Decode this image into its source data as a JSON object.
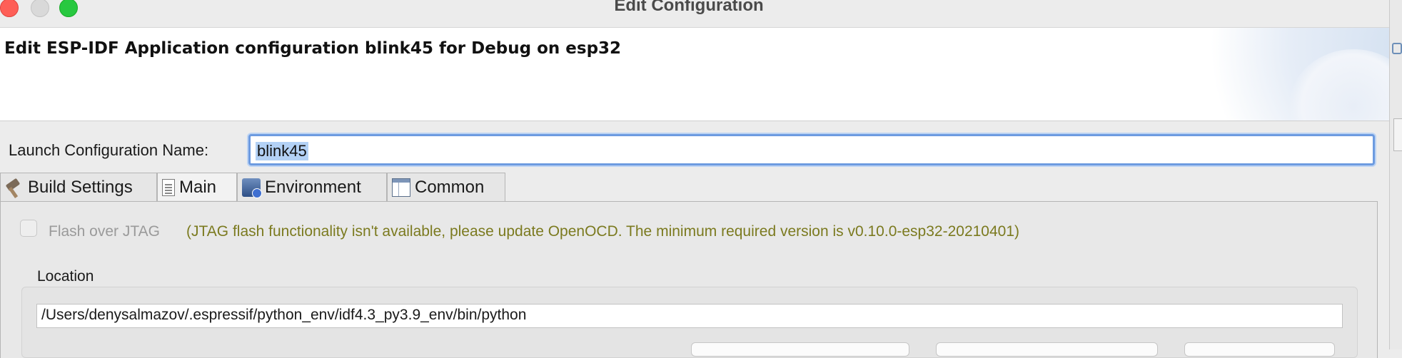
{
  "window": {
    "title": "Edit Configuration",
    "traffic_lights": [
      "close",
      "minimize",
      "zoom"
    ]
  },
  "header": {
    "title": "Edit ESP-IDF Application configuration blink45 for Debug on esp32"
  },
  "name_row": {
    "label": "Launch Configuration Name:",
    "value": "blink45"
  },
  "tabs": [
    {
      "label": "Build Settings",
      "icon": "hammer-icon",
      "active": false
    },
    {
      "label": "Main",
      "icon": "page-icon",
      "active": true
    },
    {
      "label": "Environment",
      "icon": "environment-icon",
      "active": false
    },
    {
      "label": "Common",
      "icon": "table-icon",
      "active": false
    }
  ],
  "main": {
    "flash_checkbox": {
      "label": "Flash over JTAG",
      "checked": false,
      "enabled": false
    },
    "warning": "(JTAG flash functionality isn't available, please update OpenOCD. The minimum required version is v0.10.0-esp32-20210401)",
    "location": {
      "label": "Location",
      "value": "/Users/denysalmazov/.espressif/python_env/idf4.3_py3.9_env/bin/python"
    }
  },
  "colors": {
    "warning_text": "#7b7a1f",
    "focus_ring": "#6d9be0",
    "selection": "#b3d1f5"
  }
}
